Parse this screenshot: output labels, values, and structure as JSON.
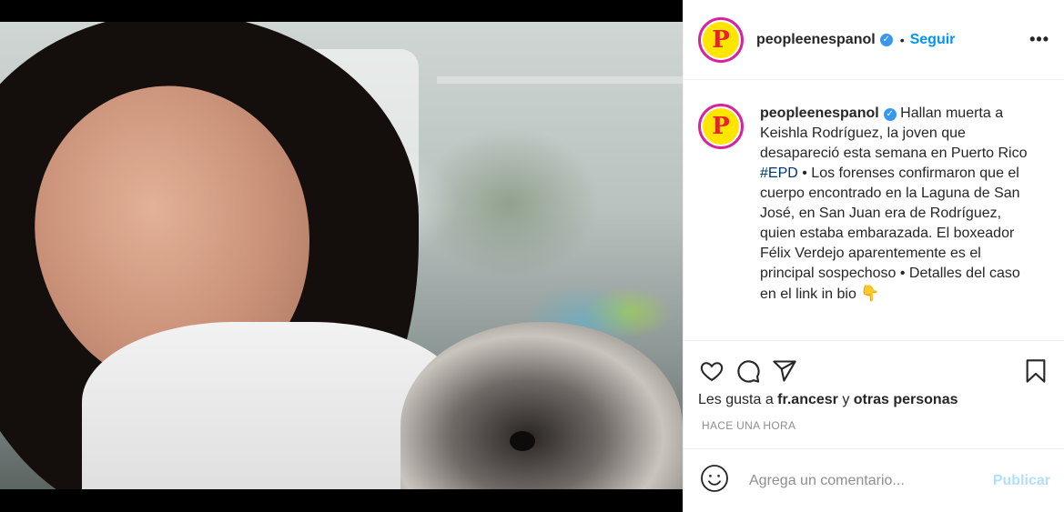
{
  "post": {
    "username": "peopleenespanol",
    "verified_icon": "verified-badge-icon",
    "separator": "•",
    "follow_label": "Seguir",
    "more_icon": "more-options-icon",
    "avatar_letter": "P"
  },
  "caption": {
    "username": "peopleenespanol",
    "text_before_tag": "Hallan muerta a Keishla Rodríguez, la joven que desapareció esta semana en Puerto Rico ",
    "hashtag": "#EPD",
    "text_after_tag": " • Los forenses confirmaron que el cuerpo encontrado en la Laguna de San José, en San Juan era de Rodríguez, quien estaba embarazada. El boxeador Félix Verdejo aparentemente es el principal sospechoso • Detalles del caso en el link in bio ",
    "emoji": "👇"
  },
  "likes": {
    "prefix": "Les gusta a ",
    "user": "fr.ancesr",
    "conjunction": " y ",
    "others": "otras personas"
  },
  "timestamp": "HACE UNA HORA",
  "comment_box": {
    "placeholder": "Agrega un comentario...",
    "publish_label": "Publicar"
  },
  "colors": {
    "link": "#0095f6",
    "hashtag": "#00376b",
    "publish_disabled": "#b2dffc",
    "avatar_bg": "#ffe500",
    "avatar_letter": "#e8222a"
  }
}
